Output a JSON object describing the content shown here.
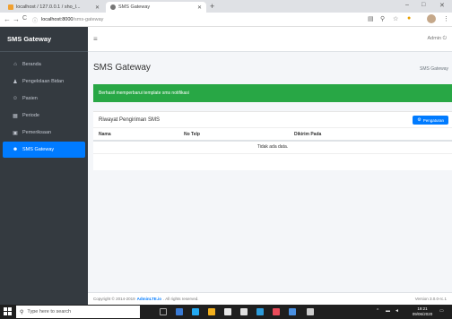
{
  "browser": {
    "tabs": [
      {
        "title": "localhost / 127.0.0.1 / sho_l...",
        "favicon": "phpmyadmin-icon",
        "color": "#f0a030"
      },
      {
        "title": "SMS Gateway",
        "favicon": "globe-icon",
        "color": "#666666"
      }
    ],
    "new_tab": "+",
    "controls": {
      "minimize": "–",
      "maximize": "□",
      "close": "✕"
    },
    "nav": {
      "back": "←",
      "forward": "→",
      "reload": "C"
    },
    "url_host": "localhost:8000",
    "url_path": "/sms-gateway"
  },
  "sidebar": {
    "brand": "SMS Gateway",
    "items": [
      {
        "label": "Beranda",
        "icon": "home-icon",
        "glyph": "⌂"
      },
      {
        "label": "Pengelolaan Bidan",
        "icon": "user-icon",
        "glyph": "♟"
      },
      {
        "label": "Pasien",
        "icon": "users-icon",
        "glyph": "☺"
      },
      {
        "label": "Periode",
        "icon": "table-icon",
        "glyph": "▦"
      },
      {
        "label": "Pemeriksaan",
        "icon": "clipboard-icon",
        "glyph": "▣"
      },
      {
        "label": "SMS Gateway",
        "icon": "users-group-icon",
        "glyph": "☻",
        "active": true
      }
    ]
  },
  "topnav": {
    "menu_icon": "≡",
    "user": "Admin"
  },
  "page": {
    "title": "SMS Gateway",
    "breadcrumb": "SMS Gateway"
  },
  "alert": {
    "message": "Berhasil memperbarui template sms notifikasi"
  },
  "card": {
    "title": "Riwayat Pengiriman SMS",
    "button": "Pengaturan",
    "columns": [
      "Nama",
      "No Telp",
      "Dikirim Pada"
    ],
    "empty": "Tidak ada data."
  },
  "footer": {
    "copyright": "Copyright © 2014-2019",
    "brand": "AdminLTE.io",
    "rights": ". All rights reserved.",
    "version": "Version 3.0.0-rc.1"
  },
  "taskbar": {
    "search_placeholder": "Type here to search",
    "time": "19:21",
    "date": "09/06/2020"
  }
}
